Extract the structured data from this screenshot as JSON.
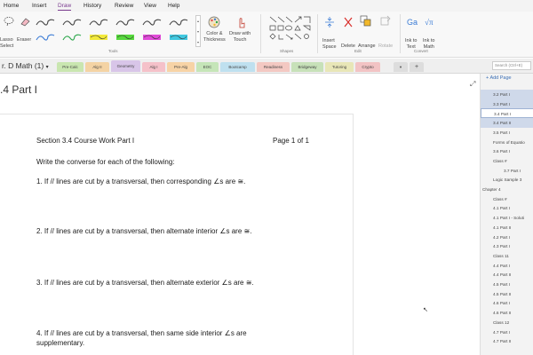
{
  "menu": [
    "Home",
    "Insert",
    "Draw",
    "History",
    "Review",
    "View",
    "Help"
  ],
  "ribbon": {
    "lasso_label": "Lasso\nSelect",
    "eraser_label": "Eraser",
    "color_thickness_label": "Color &\nThickness",
    "draw_touch_label": "Draw with\nTouch",
    "insert_space_label": "Insert\nSpace",
    "delete_label": "Delete",
    "arrange_label": "Arrange",
    "rotate_label": "Rotate",
    "ink_to_text_label": "Ink to\nText",
    "ink_to_math_label": "Ink to\nMath",
    "group_tools": "Tools",
    "group_shapes": "Shapes",
    "group_edit": "Edit",
    "group_convert": "Convert"
  },
  "notebook": {
    "name": "r. D Math (1)",
    "chevron": "▾"
  },
  "tabs": [
    {
      "label": "Pre-Calc",
      "color": "#c9e6b0"
    },
    {
      "label": "Alg II",
      "color": "#f4d3a4"
    },
    {
      "label": "Geometry",
      "color": "#d8c5e8"
    },
    {
      "label": "Alg I",
      "color": "#f5c1c9"
    },
    {
      "label": "Pre-Alg",
      "color": "#f7d3a6"
    },
    {
      "label": "EOC",
      "color": "#c5e5b8"
    },
    {
      "label": "Bootcamp",
      "color": "#bfe0ef"
    },
    {
      "label": "Readiness",
      "color": "#f3c8c2"
    },
    {
      "label": "Bridgeway",
      "color": "#c7e1b9"
    },
    {
      "label": "Tutoring",
      "color": "#e8e6b7"
    },
    {
      "label": "Crypto",
      "color": "#f2c3c4"
    }
  ],
  "search_placeholder": "Search (Ctrl+E)",
  "page_title": ".4 Part I",
  "document": {
    "header_left": "Section 3.4 Course Work Part I",
    "header_right": "Page 1 of 1",
    "instructions": "Write the converse for each of the following:",
    "items": [
      "1.  If // lines are cut by a transversal, then corresponding  ∠s are ≅.",
      "2.  If // lines are cut by a transversal, then alternate interior  ∠s are ≅.",
      "3.  If // lines are cut by a transversal, then alternate exterior  ∠s are ≅.",
      "4.  If // lines are cut by a transversal, then same side interior  ∠s are",
      "     supplementary."
    ]
  },
  "pages_pane": {
    "add_page": "Add Page",
    "items": [
      {
        "label": "3.2 Part I",
        "indent": 1,
        "selected": true
      },
      {
        "label": "3.3 Part I",
        "indent": 1,
        "selected": true
      },
      {
        "label": "3.4 Part I",
        "indent": 1,
        "selected": false,
        "current": true
      },
      {
        "label": "3.4 Part II",
        "indent": 1,
        "selected": true
      },
      {
        "label": "3.5 Part I",
        "indent": 1,
        "selected": false
      },
      {
        "label": "Forms of Equatio",
        "indent": 1,
        "selected": false
      },
      {
        "label": "3.6 Part I",
        "indent": 1,
        "selected": false
      },
      {
        "label": "Class #",
        "indent": 1,
        "selected": false
      },
      {
        "label": "3.7 Part I",
        "indent": 2,
        "selected": false
      },
      {
        "label": "Logic Sample 3",
        "indent": 1,
        "selected": false
      },
      {
        "label": "Chapter 4",
        "indent": 0,
        "selected": false
      },
      {
        "label": "Class #",
        "indent": 1,
        "selected": false
      },
      {
        "label": "4.1 Part I",
        "indent": 1,
        "selected": false
      },
      {
        "label": "4.1 Part I - Soluti",
        "indent": 1,
        "selected": false
      },
      {
        "label": "4.1 Part II",
        "indent": 1,
        "selected": false
      },
      {
        "label": "4.2 Part I",
        "indent": 1,
        "selected": false
      },
      {
        "label": "4.3 Part I",
        "indent": 1,
        "selected": false
      },
      {
        "label": "Class 11",
        "indent": 1,
        "selected": false
      },
      {
        "label": "4.4 Part I",
        "indent": 1,
        "selected": false
      },
      {
        "label": "4.4 Part II",
        "indent": 1,
        "selected": false
      },
      {
        "label": "4.5 Part I",
        "indent": 1,
        "selected": false
      },
      {
        "label": "4.5 Part II",
        "indent": 1,
        "selected": false
      },
      {
        "label": "4.6 Part I",
        "indent": 1,
        "selected": false
      },
      {
        "label": "4.6 Part II",
        "indent": 1,
        "selected": false
      },
      {
        "label": "Class 12",
        "indent": 1,
        "selected": false
      },
      {
        "label": "4.7 Part I",
        "indent": 1,
        "selected": false
      },
      {
        "label": "4.7 Part II",
        "indent": 1,
        "selected": false
      }
    ]
  },
  "pen_colors": [
    "#444444",
    "#444444",
    "#444444",
    "#444444",
    "#444444",
    "#444444",
    "#3a7bd5",
    "#2aa64a",
    "#f2e93a",
    "#57d93d",
    "#e04ad8",
    "#40c8e0"
  ]
}
